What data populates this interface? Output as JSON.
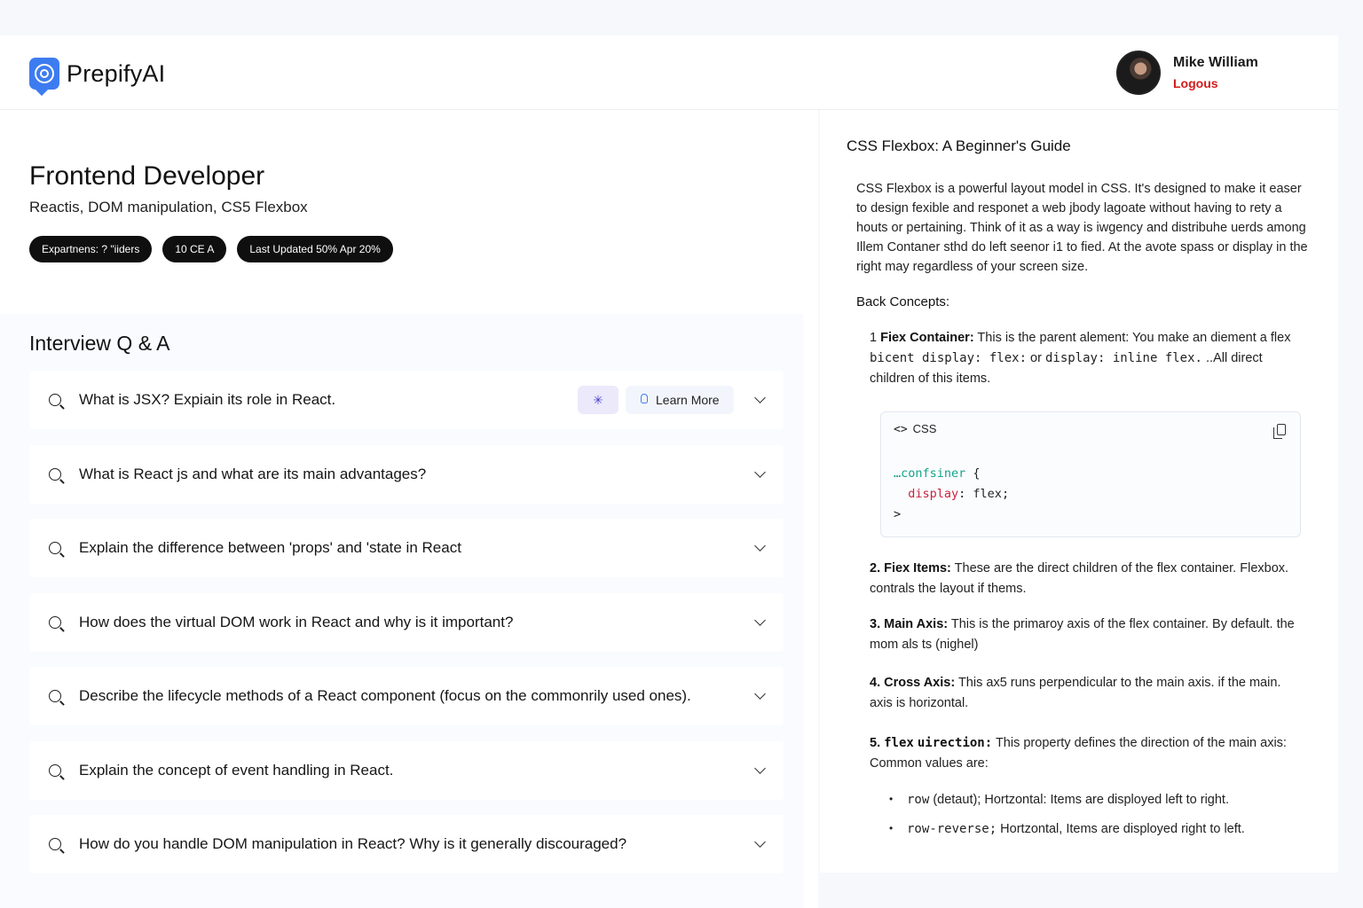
{
  "header": {
    "brand": "PrepifyAI",
    "user_name": "Mike William",
    "logout_label": "Logous"
  },
  "job": {
    "title": "Frontend Developer",
    "subtitle": "Reactis, DOM manipulation, CS5 Flexbox",
    "pills": [
      "Expartnens: ? \"iiders",
      "10 CE A",
      "Last Updated 50% Apr 20%"
    ]
  },
  "qa": {
    "title": "Interview Q & A",
    "ai_label": "✳",
    "learn_more_label": "Learn More",
    "questions": [
      "What is JSX? Expiain its role in React.",
      "What is React js and what are its main advantages?",
      "Explain the difference between 'props' and 'state in React",
      "How does the virtual DOM work in React and why is it important?",
      "Describe the lifecycle methods of a React component (focus on the commonrily used ones).",
      "Explain the concept of event handling in React.",
      "How do you handle DOM manipulation in React? Why is it generally discouraged?"
    ]
  },
  "article": {
    "title": "CSS Flexbox: A Beginner's Guide",
    "intro": "CSS Flexbox is a powerful layout model in CSS. It's designed to make it easer to design fexible and responet a web jbody lagoate without having to rety a houts or pertaining. Think of it as a way is iwgency and distribuhe uerds among Illem Contaner sthd do left seenor i1 to fied. At the avote spass or display in the right may regardless of your screen size.",
    "back_concepts": "Back Concepts:",
    "item1": {
      "num": "1",
      "label": "Fiex Container:",
      "text_a": " This is the parent alement: You make an diement a flex ",
      "code_a": "bicent",
      "code_b": " display: flex:",
      "text_b": " or ",
      "code_c": "display: inline flex.",
      "text_c": " ..All direct children of this items."
    },
    "code_block": {
      "lang": "CSS",
      "line1_sel": "…confsiner",
      "line1_rest": " {",
      "line2_prop": "display",
      "line2_rest": ": flex;",
      "line3": ">"
    },
    "item2": {
      "num": "2.",
      "label": "Fiex Items:",
      "text": " These are the direct children of the flex container. Flexbox. contrals the layout if thems."
    },
    "item3": {
      "num": "3.",
      "label": "Main Axis:",
      "text": " This is the primaroy axis of the flex container. By default. the mom als ts (nighel)"
    },
    "item4": {
      "num": "4.",
      "label": "Cross Axis:",
      "text": " This ax5 runs perpendicular to the main axis. if the main. axis is horizontal."
    },
    "item5": {
      "num": "5.",
      "code_a": "flex",
      "code_b": "uirection:",
      "text": " This property defines the direction of the main axis: Common values are:"
    },
    "bullets": [
      {
        "code": "row",
        "text": " (detaut);   Hortzontal:  Items are disployed left to right."
      },
      {
        "code": "row-reverse;",
        "text": " Hortzontal, Items are disployed right to left."
      }
    ]
  }
}
